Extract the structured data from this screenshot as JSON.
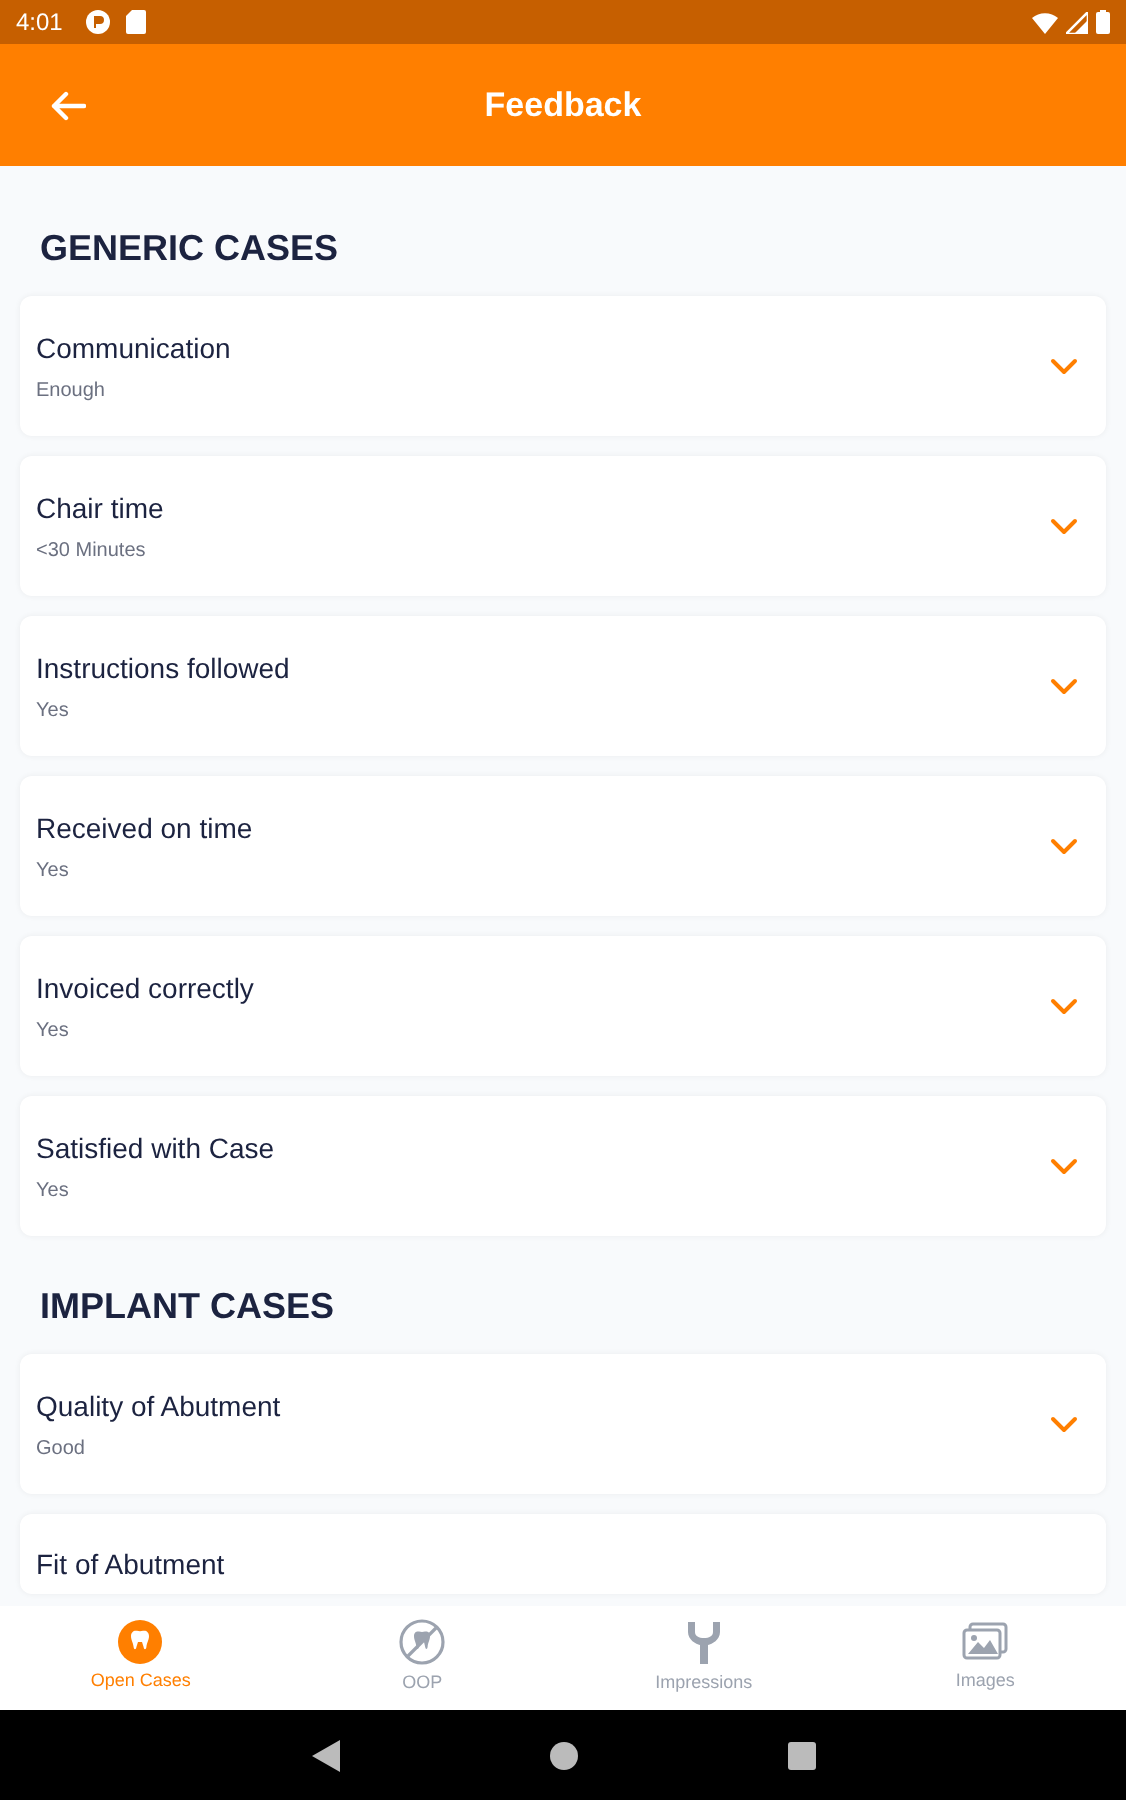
{
  "status_bar": {
    "time": "4:01"
  },
  "app_bar": {
    "title": "Feedback"
  },
  "sections": [
    {
      "title": "GENERIC CASES",
      "items": [
        {
          "label": "Communication",
          "value": "Enough"
        },
        {
          "label": "Chair time",
          "value": "<30 Minutes"
        },
        {
          "label": "Instructions followed",
          "value": "Yes"
        },
        {
          "label": "Received on time",
          "value": "Yes"
        },
        {
          "label": "Invoiced correctly",
          "value": "Yes"
        },
        {
          "label": "Satisfied with Case",
          "value": "Yes"
        }
      ]
    },
    {
      "title": "IMPLANT CASES",
      "items": [
        {
          "label": "Quality of Abutment",
          "value": "Good"
        },
        {
          "label": "Fit of Abutment"
        }
      ]
    }
  ],
  "bottom_nav": [
    {
      "label": "Open Cases",
      "kind": "tooth",
      "selected": true
    },
    {
      "label": "OOP",
      "kind": "oop",
      "selected": false
    },
    {
      "label": "Impressions",
      "kind": "fork",
      "selected": false
    },
    {
      "label": "Images",
      "kind": "images",
      "selected": false
    }
  ]
}
